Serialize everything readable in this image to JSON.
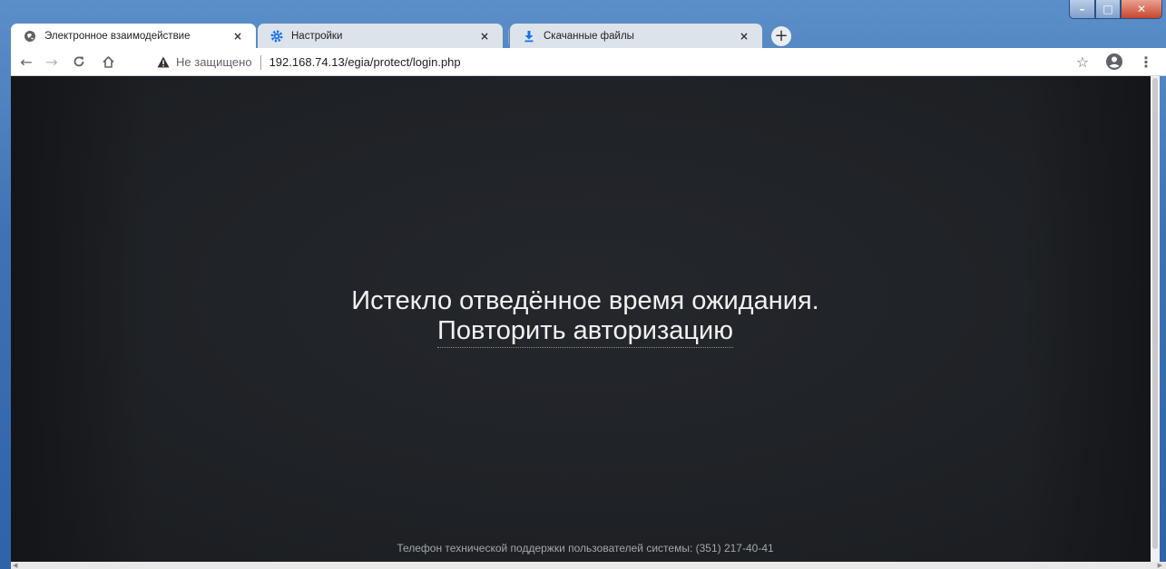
{
  "browser": {
    "tabs": [
      {
        "title": "Электронное взаимодействие",
        "icon": "globe-icon",
        "active": true
      },
      {
        "title": "Настройки",
        "icon": "gear-icon",
        "active": false
      },
      {
        "title": "Скачанные файлы",
        "icon": "download-icon",
        "active": false
      }
    ],
    "new_tab_glyph": "+",
    "close_glyph": "×",
    "security_label": "Не защищено",
    "url": "192.168.74.13/egia/protect/login.php"
  },
  "page": {
    "message": "Истекло отведённое время ожидания.",
    "relogin_link": "Повторить авторизацию",
    "support_text": "Телефон технической поддержки пользователей системы: (351) 217-40-41"
  },
  "colors": {
    "page_background": "#1f2226",
    "message_text": "#f1f1f1",
    "footer_text": "#a3a6aa",
    "window_frame": "#3f73b5"
  }
}
